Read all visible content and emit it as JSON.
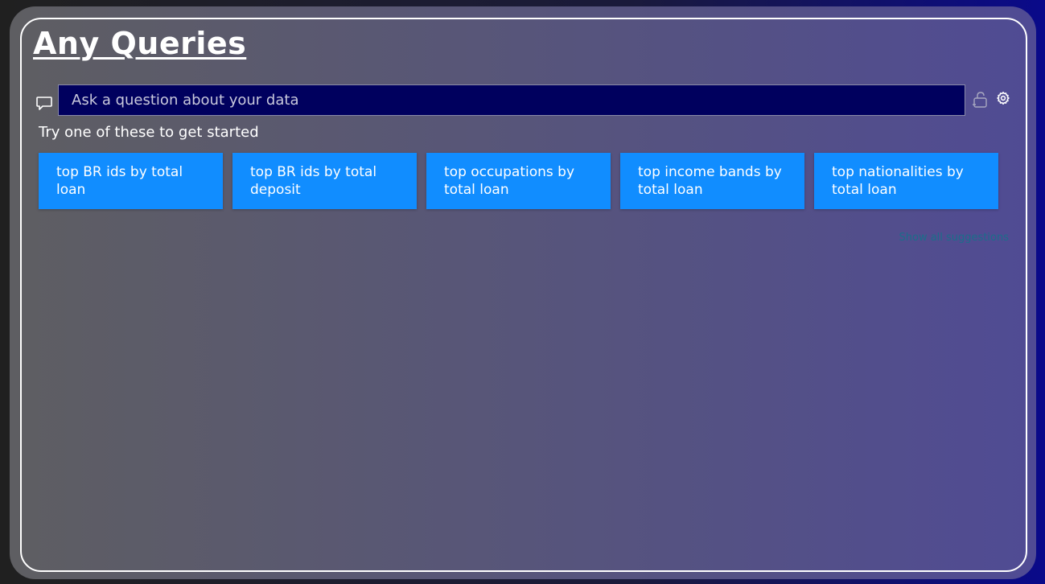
{
  "page": {
    "title": "Any Queries"
  },
  "qa": {
    "placeholder": "Ask a question about your data",
    "value": ""
  },
  "suggestions_section": {
    "label": "Try one of these to get started",
    "items": [
      {
        "label": "top BR ids by total loan"
      },
      {
        "label": "top BR ids by total deposit"
      },
      {
        "label": "top occupations by total loan"
      },
      {
        "label": "top income bands by total loan"
      },
      {
        "label": "top nationalities by total loan"
      }
    ],
    "show_all_label": "Show all suggestions"
  },
  "icons": {
    "chat": "chat-bubble-icon",
    "lock": "unlock-icon",
    "settings": "gear-icon"
  },
  "colors": {
    "accent": "#118dff",
    "input_bg": "#00005e",
    "title": "#ffffff",
    "link": "#1a6e8a"
  }
}
